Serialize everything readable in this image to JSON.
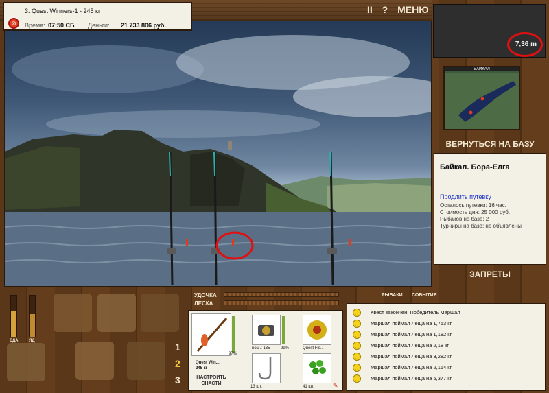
{
  "info": {
    "tournament": "3. Quest Winners-1 - 245 кг",
    "time_label": "Время:",
    "time_value": "07:50 СБ",
    "money_label": "Деньги:",
    "money_value": "21 733 806 руб."
  },
  "top_controls": {
    "pause": "II",
    "help": "?",
    "menu": "МЕНЮ"
  },
  "distance": "7,36 m",
  "map": {
    "title": "БАЙКАЛ"
  },
  "back_to_base": "ВЕРНУТЬСЯ НА БАЗУ",
  "base": {
    "name": "Байкал. Бора-Елга",
    "extend_link": "Продлить путевку",
    "trip_left": "Осталось путевки: 16 час.",
    "day_cost": "Стоимость дня: 25 000 руб.",
    "fishers": "Рыбаков на базе: 2",
    "tournaments": "Турниры на базе: не объявлены"
  },
  "bans": "ЗАПРЕТЫ",
  "gauges": {
    "food_label": "ЕДА",
    "food_level": 0.62,
    "poison_label": "ЯД",
    "poison_level": 0.55
  },
  "slots": [
    "1",
    "2",
    "3"
  ],
  "line_controls": {
    "rods_label": "УДОЧКА",
    "line_label": "ЛЕСКА"
  },
  "tabs": {
    "fishers": "РЫБАКИ",
    "events": "СОБЫТИЯ"
  },
  "gear": {
    "rod_percent": "97%",
    "rod_name": "Quest Win...",
    "rod_weight": "245 кг",
    "reel_caption": "нош.: 135",
    "reel_percent": "99%",
    "line_caption": "Quest Fis...",
    "hook_caption": "13 шт.",
    "bait_caption": "41 шт.",
    "setup_button": "НАСТРОИТЬ СНАСТИ"
  },
  "events": [
    "Квест закончен! Победитель Маршал",
    "Маршал поймал Леща на 1,753 кг",
    "Маршал поймал Леща на 1,182 кг",
    "Маршал поймал Леща на 2,18 кг",
    "Маршал поймал Леща на 3,282 кг",
    "Маршал поймал Леща на 2,164 кг",
    "Маршал поймал Леща на 5,377 кг"
  ],
  "colors": {
    "panel": "#f3f1e6",
    "wood": "#5a3718",
    "highlight_ring": "#e01010",
    "link": "#1a2fc7"
  }
}
